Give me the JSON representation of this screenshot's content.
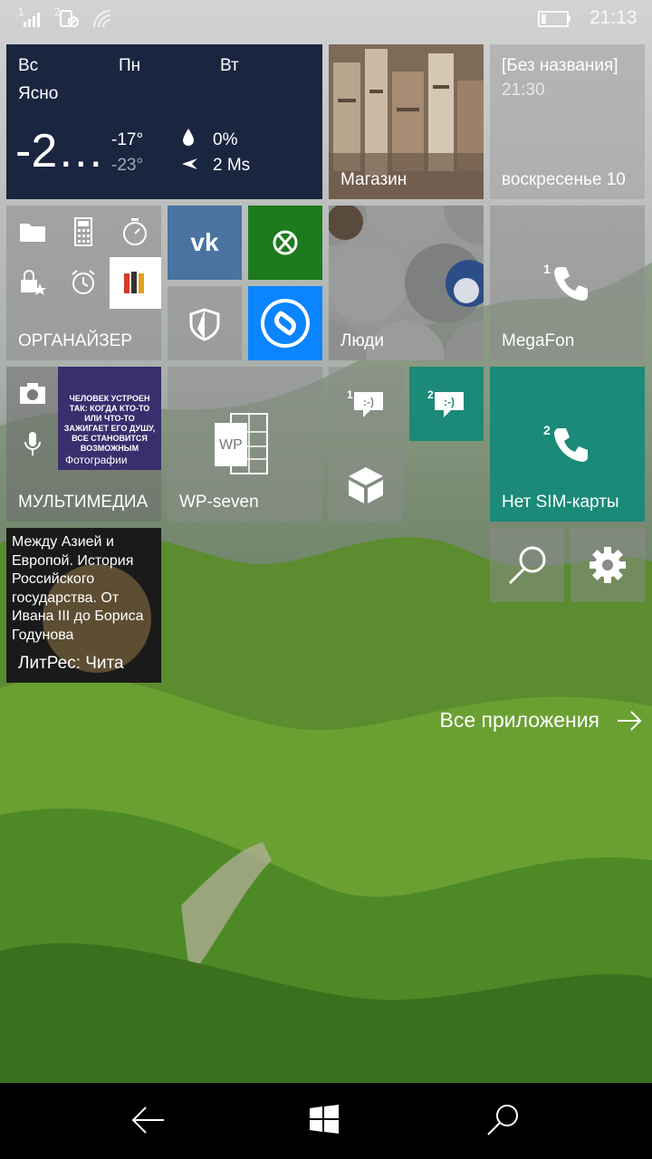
{
  "status_bar": {
    "sim1_indicator": "1",
    "sim2_indicator": "2",
    "time": "21:13"
  },
  "weather": {
    "day1": "Вс",
    "day2": "Пн",
    "day3": "Вт",
    "condition": "Ясно",
    "temp_main": "-2…",
    "temp_high": "-17°",
    "temp_low": "-23°",
    "precip": "0%",
    "wind": "2 Ms"
  },
  "store_tile": {
    "label": "Магазин"
  },
  "calendar_tile": {
    "title": "[Без названия]",
    "time": "21:30",
    "date": "воскресенье 10"
  },
  "organizer_tile": {
    "label": "ОРГАНАЙЗЕР"
  },
  "people_tile": {
    "label": "Люди"
  },
  "megafon_tile": {
    "label": "MegaFon",
    "badge": "1"
  },
  "multimedia_tile": {
    "label": "МУЛЬТИМЕДИА",
    "photo_text": "ЧЕЛОВЕК УСТРОЕН ТАК: КОГДА КТО-ТО ИЛИ ЧТО-ТО ЗАЖИГАЕТ ЕГО ДУШУ, ВСЕ СТАНОВИТСЯ ВОЗМОЖНЫМ",
    "photo_caption": "Фотографии"
  },
  "wpseven_tile": {
    "label": "WP-seven",
    "logo_text": "WP"
  },
  "messaging_tiles": {
    "badge1": "1",
    "badge2": "2"
  },
  "nosim_tile": {
    "label": "Нет SIM-карты",
    "badge": "2"
  },
  "litres_tile": {
    "book_text": "Между Азией и Европой. История Российского государства. От Ивана III до Бориса Годунова",
    "label": "ЛитРес: Чита"
  },
  "all_apps": {
    "label": "Все приложения"
  },
  "colors": {
    "vk": "#4a73a0",
    "xbox": "#1d7a1d",
    "shazam": "#0a84ff",
    "teal": "#1b8a78",
    "weather_bg": "#1a2540"
  }
}
